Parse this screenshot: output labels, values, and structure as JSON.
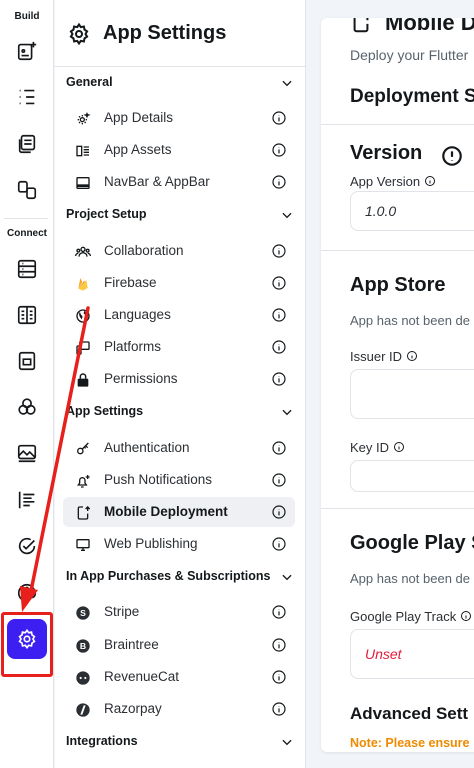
{
  "rail": {
    "build_label": "Build",
    "connect_label": "Connect",
    "icons": [
      "add-page-icon",
      "widget-tree-icon",
      "storyboard-icon",
      "components-icon",
      "database-icon",
      "api-calls-icon",
      "media-assets-icon",
      "theme-icon",
      "image-assets-icon",
      "custom-code-icon",
      "cloud-functions-icon",
      "palette-icon",
      "settings-icon"
    ]
  },
  "panel": {
    "title": "App Settings",
    "sections": {
      "general": {
        "title": "General",
        "items": [
          "App Details",
          "App Assets",
          "NavBar & AppBar"
        ]
      },
      "project_setup": {
        "title": "Project Setup",
        "items": [
          "Collaboration",
          "Firebase",
          "Languages",
          "Platforms",
          "Permissions"
        ]
      },
      "app_settings": {
        "title": "App Settings",
        "items": [
          "Authentication",
          "Push Notifications",
          "Mobile Deployment",
          "Web Publishing"
        ]
      },
      "iap": {
        "title": "In App Purchases & Subscriptions",
        "items": [
          "Stripe",
          "Braintree",
          "RevenueCat",
          "Razorpay"
        ]
      },
      "integrations": {
        "title": "Integrations"
      }
    },
    "active_item": "Mobile Deployment"
  },
  "main": {
    "page_title": "Mobile D",
    "page_subtitle": "Deploy your Flutter",
    "deployment_heading": "Deployment S",
    "version": {
      "title": "Version",
      "app_version_label": "App Version",
      "app_version_value": "1.0.0"
    },
    "app_store": {
      "title": "App Store",
      "status": "App has not been de",
      "issuer_id_label": "Issuer ID",
      "key_id_label": "Key ID"
    },
    "google_play": {
      "title": "Google Play S",
      "status": "App has not been de",
      "track_label": "Google Play Track",
      "track_value": "Unset"
    },
    "advanced": {
      "title": "Advanced Sett",
      "note": "Note: Please ensure"
    }
  },
  "colors": {
    "accent": "#3d1ff2",
    "highlight_red": "#e8201c",
    "note_orange": "#ee8b00",
    "unset_red": "#e21c3d"
  }
}
